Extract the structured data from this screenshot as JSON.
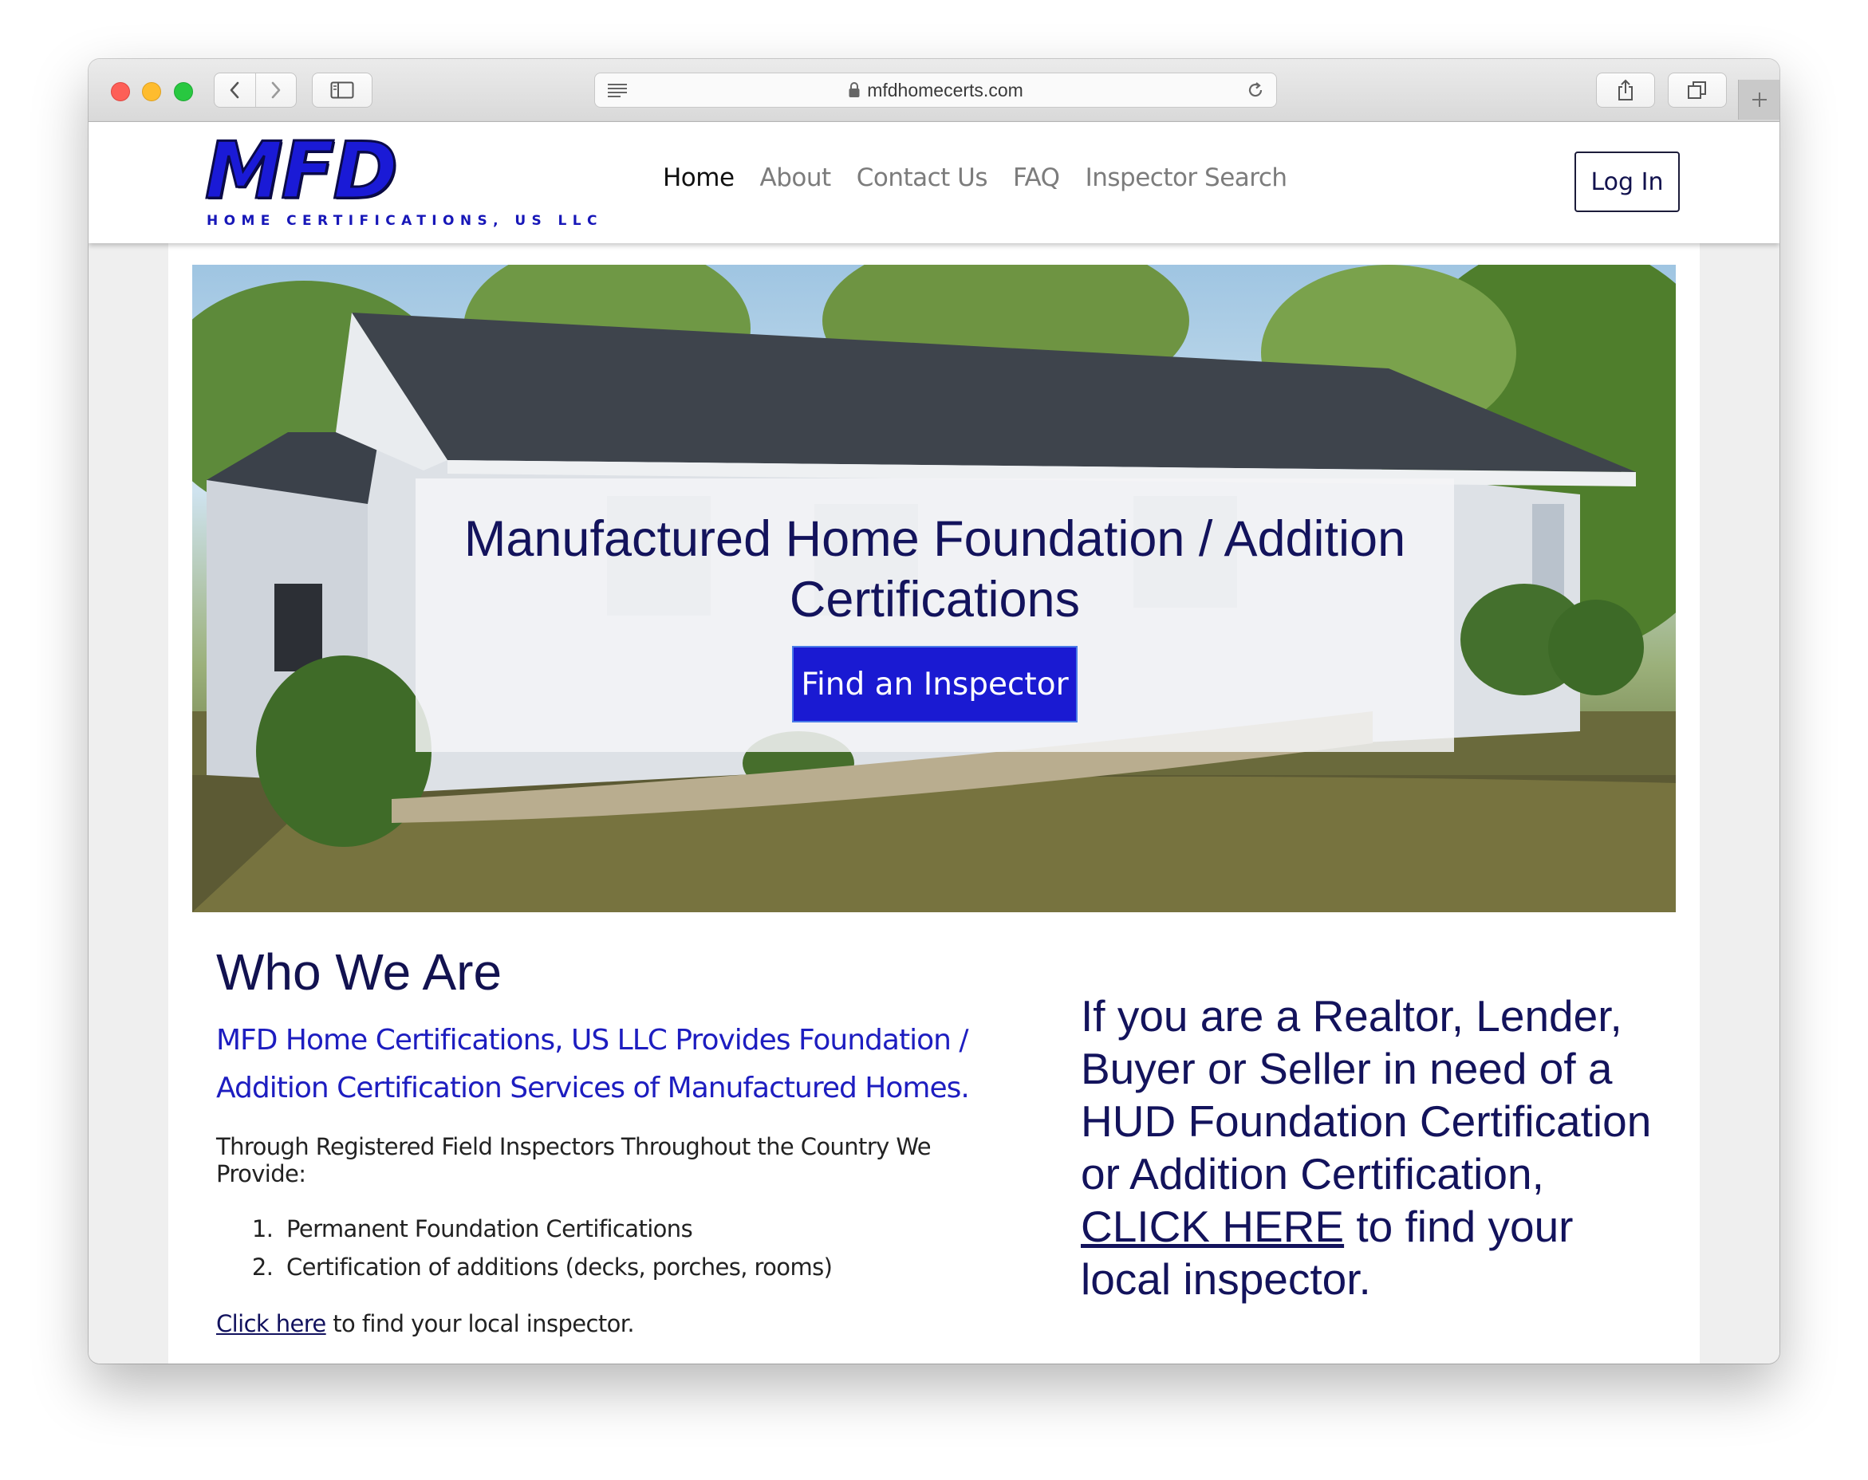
{
  "browser": {
    "url": "mfdhomecerts.com",
    "icons": {
      "back": "chevron-left-icon",
      "forward": "chevron-right-icon",
      "sidebar": "sidebar-icon",
      "reader": "reader-lines-icon",
      "lock": "lock-icon",
      "reload": "reload-icon",
      "share": "share-icon",
      "tabs": "tabs-icon",
      "new_tab": "plus-icon"
    }
  },
  "header": {
    "logo": {
      "wordmark": "MFD",
      "tagline": "HOME CERTIFICATIONS, US LLC"
    },
    "nav": [
      {
        "label": "Home",
        "active": true
      },
      {
        "label": "About",
        "active": false
      },
      {
        "label": "Contact Us",
        "active": false
      },
      {
        "label": "FAQ",
        "active": false
      },
      {
        "label": "Inspector Search",
        "active": false
      }
    ],
    "login_label": "Log In"
  },
  "hero": {
    "title": "Manufactured Home Foundation / Addition Certifications",
    "button_label": "Find an Inspector"
  },
  "who": {
    "title": "Who We Are",
    "subtitle": "MFD Home Certifications, US LLC Provides Foundation / Addition Certification Services of Manufactured Homes.",
    "intro": "Through Registered Field Inspectors Throughout the Country We Provide:",
    "list": [
      "Permanent Foundation Certifications",
      "Certification of additions (decks, porches, rooms)"
    ],
    "click_link": "Click here",
    "click_rest": " to find your local inspector."
  },
  "callout": {
    "text_before": "If you are a Realtor, Lender, Buyer or Seller in need of a HUD Foundation Certification or Addition Certification, ",
    "link": "CLICK HERE",
    "text_after": " to find your local inspector."
  },
  "colors": {
    "brand_blue": "#1a1ad2",
    "navy_text": "#13135c",
    "subtitle_blue": "#1d1dc0"
  }
}
